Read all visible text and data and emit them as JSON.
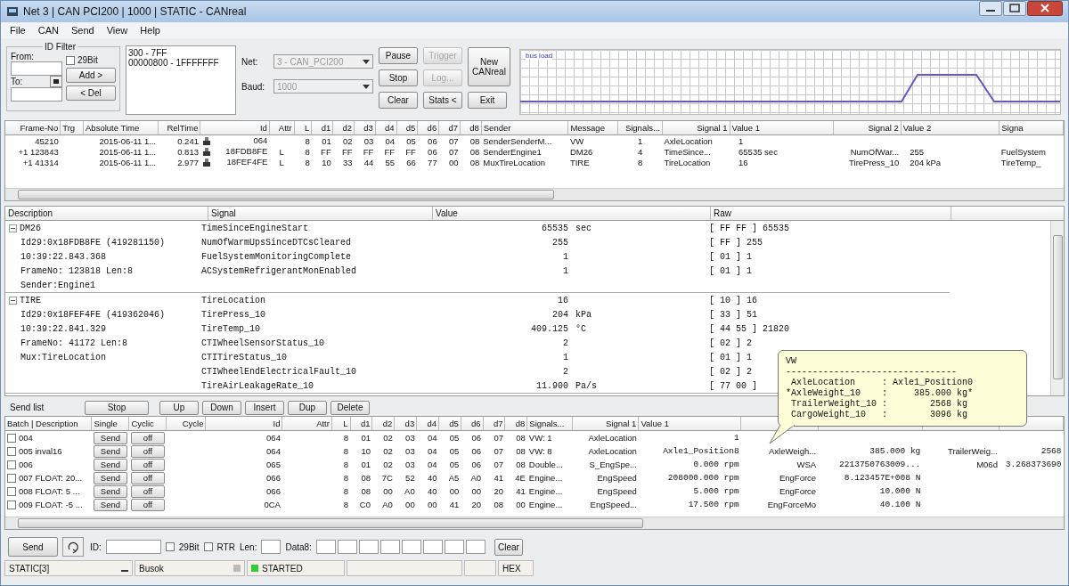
{
  "window": {
    "title": "Net 3 | CAN PCI200 | 1000 | STATIC - CANreal"
  },
  "menu": [
    "File",
    "CAN",
    "Send",
    "View",
    "Help"
  ],
  "id_filter": {
    "title": "ID Filter",
    "from_label": "From:",
    "to_label": "To:",
    "bit29": {
      "label": "29Bit",
      "checked": false
    },
    "add": "Add >",
    "del": "< Del",
    "entries": [
      "300 - 7FF",
      "00000800 - 1FFFFFFF"
    ]
  },
  "net": {
    "label": "Net:",
    "value": "3 - CAN_PCI200",
    "disabled": true
  },
  "baud": {
    "label": "Baud:",
    "value": "1000",
    "disabled": true
  },
  "buttons": [
    {
      "label": "Pause",
      "disabled": false
    },
    {
      "label": "Trigger",
      "disabled": true
    },
    {
      "label": "Stop",
      "disabled": false
    },
    {
      "label": "Log...",
      "disabled": true
    },
    {
      "label": "Clear",
      "disabled": false
    },
    {
      "label": "Stats <",
      "disabled": false
    }
  ],
  "new_button": "New CANreal",
  "exit_button": "Exit",
  "graph": {
    "label": "bus load"
  },
  "frames": {
    "columns": [
      "Frame-No",
      "Trg",
      "Absolute Time",
      "RelTime",
      "Id",
      "Attr",
      "L",
      "d1",
      "d2",
      "d3",
      "d4",
      "d5",
      "d6",
      "d7",
      "d8",
      "Sender",
      "Message",
      "Signals...",
      "Signal 1",
      "Value 1",
      "Signal 2",
      "Value 2",
      "Signa"
    ],
    "rows": [
      {
        "frame": "45210",
        "trg": "",
        "time": "2015-06-11 1...",
        "rel": "0.241",
        "id": "064",
        "attr": "",
        "len": "8",
        "data": [
          "01",
          "02",
          "03",
          "04",
          "05",
          "06",
          "07",
          "08"
        ],
        "sender": "SenderSenderM...",
        "message": "VW",
        "signals": "1",
        "signal1": "AxleLocation",
        "value1": "1",
        "signal2": "",
        "value2": "",
        "signal3": ""
      },
      {
        "frame": "+1 123843",
        "trg": "",
        "time": "2015-06-11 1...",
        "rel": "0.813",
        "id": "18FDB8FE",
        "attr": "L",
        "len": "8",
        "data": [
          "FF",
          "FF",
          "FF",
          "FF",
          "FF",
          "06",
          "07",
          "08"
        ],
        "sender": "SenderEngine1",
        "message": "DM26",
        "signals": "4",
        "signal1": "TimeSince...",
        "value1": "65535 sec",
        "signal2": "NumOfWar...",
        "value2": "255",
        "signal3": "FuelSystem"
      },
      {
        "frame": "+1 41314",
        "trg": "",
        "time": "2015-06-11 1...",
        "rel": "2.977",
        "id": "18FEF4FE",
        "attr": "L",
        "len": "8",
        "data": [
          "10",
          "33",
          "44",
          "55",
          "66",
          "77",
          "00",
          "08"
        ],
        "sender": "MuxTireLocation",
        "message": "TIRE",
        "signals": "8",
        "signal1": "TireLocation",
        "value1": "16",
        "signal2": "TirePress_10",
        "value2": "204 kPa",
        "signal3": "TireTemp_"
      }
    ]
  },
  "details": {
    "columns": [
      "Description",
      "Signal",
      "Value",
      "Raw"
    ],
    "groups": [
      {
        "expanded": true,
        "description": [
          "DM26",
          "Id29:0x18FDB8FE (419281150)",
          "10:39:22.843.368",
          "FrameNo: 123818 Len:8",
          "Sender:Engine1"
        ],
        "signals": [
          {
            "name": "TimeSinceEngineStart",
            "value": "65535",
            "unit": "sec",
            "raw": "[ FF FF ] 65535"
          },
          {
            "name": "NumOfWarmUpsSinceDTCsCleared",
            "value": "255",
            "raw": "[ FF ] 255"
          },
          {
            "name": "FuelSystemMonitoringComplete",
            "value": "1",
            "raw": "[ 01 ] 1"
          },
          {
            "name": "ACSystemRefrigerantMonEnabled",
            "value": "1",
            "raw": "[ 01 ] 1"
          }
        ]
      },
      {
        "expanded": true,
        "description": [
          "TIRE",
          "Id29:0x18FEF4FE (419362046)",
          "10:39:22.841.329",
          "FrameNo: 41172 Len:8",
          "Mux:TireLocation"
        ],
        "signals": [
          {
            "name": "TireLocation",
            "value": "16",
            "raw": "[ 10 ] 16"
          },
          {
            "name": "TirePress_10",
            "value": "204",
            "unit": "kPa",
            "raw": "[ 33 ] 51"
          },
          {
            "name": "TireTemp_10",
            "value": "409.125",
            "unit": "°C",
            "raw": "[ 44 55 ] 21820"
          },
          {
            "name": "CTIWheelSensorStatus_10",
            "value": "2",
            "raw": "[ 02 ] 2"
          },
          {
            "name": "CTITireStatus_10",
            "value": "1",
            "raw": "[ 01 ] 1"
          },
          {
            "name": "CTIWheelEndElectricalFault_10",
            "value": "2",
            "raw": "[ 02 ] 2"
          },
          {
            "name": "TireAirLeakageRate_10",
            "value": "11.900",
            "unit": "Pa/s",
            "raw": "[ 77 00 ]"
          }
        ]
      }
    ]
  },
  "send_list": {
    "title": "Send list",
    "buttons": [
      "Stop",
      "Up",
      "Down",
      "Insert",
      "Dup",
      "Delete"
    ],
    "columns": [
      "Batch | Description",
      "Single",
      "Cyclic",
      "Cycle",
      "Id",
      "Attr",
      "L",
      "d1",
      "d2",
      "d3",
      "d4",
      "d5",
      "d6",
      "d7",
      "d8",
      "Signals...",
      "Signal 1",
      "Value 1"
    ],
    "rows": [
      {
        "checked": false,
        "desc": "004",
        "send": "Send",
        "cyclic": "off",
        "id": "064",
        "len": "8",
        "data": [
          "01",
          "02",
          "03",
          "04",
          "05",
          "06",
          "07",
          "08"
        ],
        "signals": "VW: 1",
        "signal1": "AxleLocation",
        "value1": "1",
        "signal2": "",
        "value2": "",
        "signal3": "",
        "value3": ""
      },
      {
        "checked": false,
        "desc": "005 inval16",
        "send": "Send",
        "cyclic": "off",
        "id": "064",
        "len": "8",
        "data": [
          "10",
          "02",
          "03",
          "04",
          "05",
          "06",
          "07",
          "08"
        ],
        "signals": "VW: 8",
        "signal1": "AxleLocation",
        "value1": "Axle1_Position8",
        "signal2": "AxleWeigh...",
        "value2": "385.000 kg",
        "signal3": "TrailerWeig...",
        "value3": "2568"
      },
      {
        "checked": false,
        "desc": "006",
        "send": "Send",
        "cyclic": "off",
        "id": "065",
        "len": "8",
        "data": [
          "01",
          "02",
          "03",
          "04",
          "05",
          "06",
          "07",
          "08"
        ],
        "signals": "Double...",
        "signal1": "S_EngSpe...",
        "value1": "0.000 rpm",
        "signal2": "WSA",
        "value2": "2213750763009...",
        "signal3": "M06d",
        "value3": "3.268373690"
      },
      {
        "checked": false,
        "desc": "007 FLOAT: 20...",
        "send": "Send",
        "cyclic": "off",
        "id": "066",
        "len": "8",
        "data": [
          "08",
          "7C",
          "52",
          "40",
          "A5",
          "A0",
          "41",
          "4E"
        ],
        "signals": "Engine...",
        "signal1": "EngSpeed",
        "value1": "208000.000 rpm",
        "signal2": "EngForce",
        "value2": "8.123457E+008 N",
        "signal3": "",
        "value3": ""
      },
      {
        "checked": false,
        "desc": "008 FLOAT: 5 ...",
        "send": "Send",
        "cyclic": "off",
        "id": "066",
        "len": "8",
        "data": [
          "08",
          "00",
          "A0",
          "40",
          "00",
          "00",
          "20",
          "41"
        ],
        "signals": "Engine...",
        "signal1": "EngSpeed",
        "value1": "5.000 rpm",
        "signal2": "EngForce",
        "value2": "10.000 N",
        "signal3": "",
        "value3": ""
      },
      {
        "checked": false,
        "desc": "009 FLOAT: -5 ...",
        "send": "Send",
        "cyclic": "off",
        "id": "0CA",
        "len": "8",
        "data": [
          "C0",
          "A0",
          "00",
          "00",
          "41",
          "20",
          "08",
          "00"
        ],
        "signals": "Engine...",
        "signal1": "EngSpeed...",
        "value1": "17.500 rpm",
        "signal2": "EngForceMo",
        "value2": "40.100 N",
        "signal3": "",
        "value3": ""
      }
    ]
  },
  "send_bar": {
    "send": "Send",
    "id_label": "ID:",
    "bit29": {
      "label": "29Bit",
      "checked": false
    },
    "rtr": {
      "label": "RTR",
      "checked": false
    },
    "len_label": "Len:",
    "data_label": "Data8:",
    "clear": "Clear"
  },
  "tooltip": {
    "lines": [
      "VW",
      "--------------------------------",
      " AxleLocation     : Axle1_Position0",
      "*AxleWeight_10    :     385.000 kg*",
      " TrailerWeight_10 :        2568 kg",
      " CargoWeight_10   :        3096 kg"
    ]
  },
  "status_bar": [
    {
      "kind": "text",
      "text": "STATIC[3]"
    },
    {
      "kind": "indicator",
      "text": "Busok",
      "on": false
    },
    {
      "kind": "indicator",
      "text": "STARTED",
      "on": true
    },
    {
      "kind": "text"
    },
    {
      "kind": "text"
    },
    {
      "kind": "text",
      "text": "HEX"
    }
  ]
}
